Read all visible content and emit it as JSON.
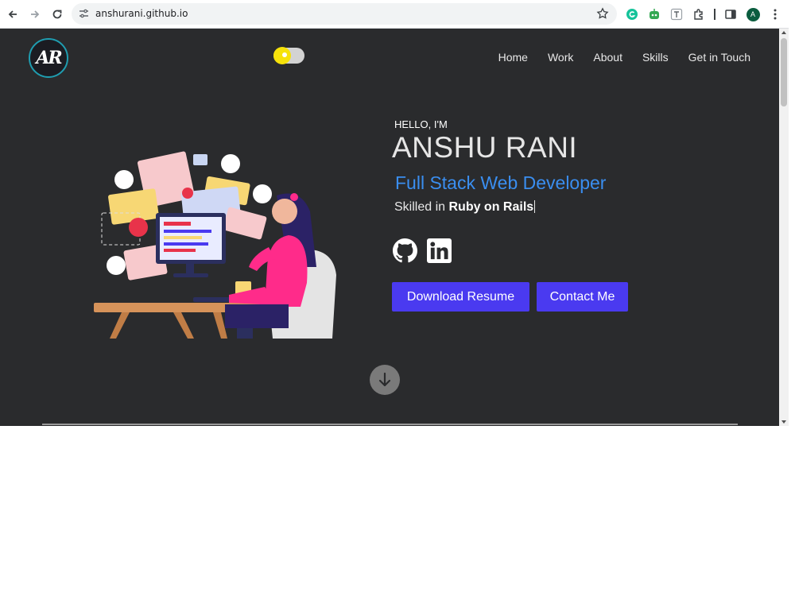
{
  "browser": {
    "url": "anshurani.github.io",
    "profile_initial": "A"
  },
  "site": {
    "logo_text": "AR",
    "nav": [
      "Home",
      "Work",
      "About",
      "Skills",
      "Get in Touch"
    ],
    "hero": {
      "greeting": "HELLO, I'M",
      "name": "ANSHU RANI",
      "role": "Full Stack Web Developer",
      "skilled_prefix": "Skilled in",
      "skilled_value": "Ruby on Rails"
    },
    "buttons": {
      "resume": "Download Resume",
      "contact": "Contact Me"
    }
  },
  "colors": {
    "page_bg": "#2a2b2d",
    "accent_blue": "#3a8ef0",
    "button_bg": "#4a3af0",
    "toggle_knob": "#f6e20a"
  }
}
